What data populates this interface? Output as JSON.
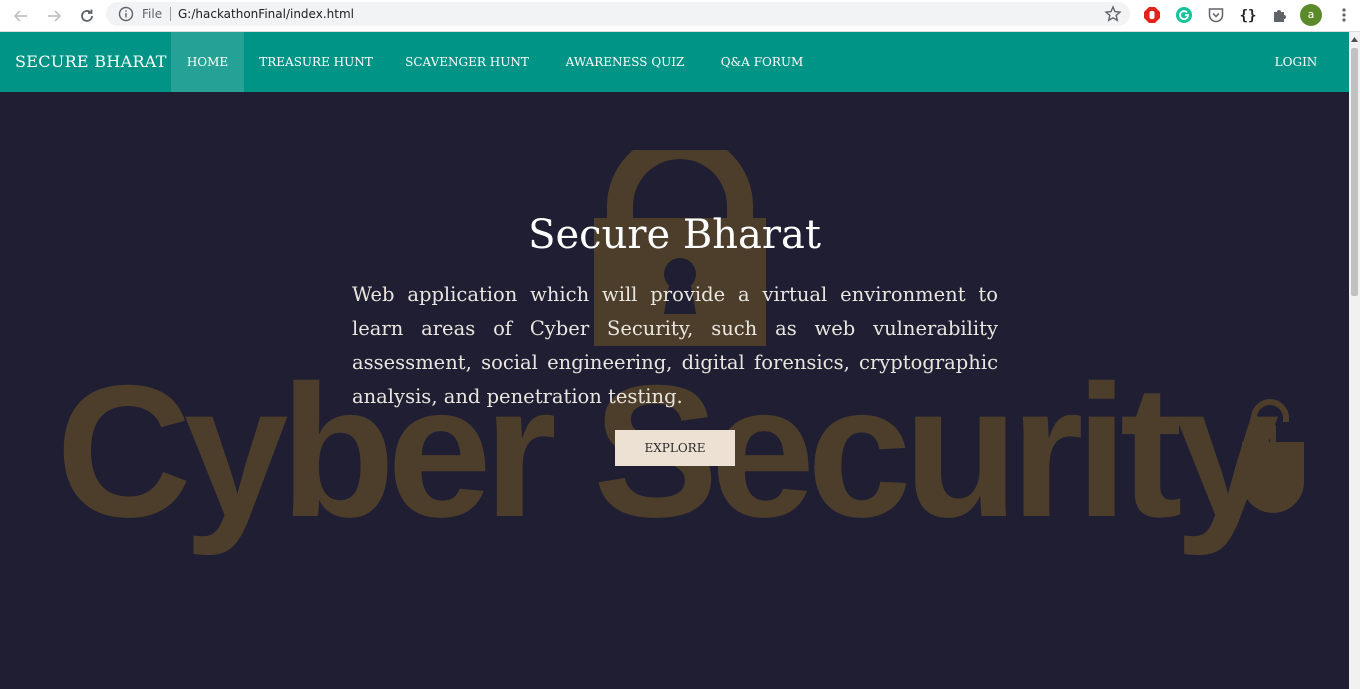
{
  "browser": {
    "omnibox": {
      "scheme_label": "File",
      "url": "G:/hackathonFinal/index.html"
    },
    "profile_initial": "a",
    "extensions": [
      "adblock-icon",
      "grammarly-icon",
      "pocket-icon",
      "json-viewer-icon",
      "puzzle-icon"
    ],
    "colors": {
      "adblock": "#e2231a",
      "grammarly": "#15c39a",
      "profile": "#5b8a2a"
    }
  },
  "site": {
    "brand": "SECURE BHARAT",
    "nav": {
      "home": "HOME",
      "treasure_hunt": "TREASURE HUNT",
      "scavenger_hunt": "SCAVENGER HUNT",
      "awareness_quiz": "AWARENESS QUIZ",
      "qa_forum": "Q&A FORUM",
      "login": "LOGIN"
    },
    "colors": {
      "navbar": "#009487",
      "hero_bg": "#1f1e32",
      "button_bg": "#ede1d4"
    }
  },
  "hero": {
    "background_text": "Cyber Security",
    "title": "Secure Bharat",
    "description": "Web application which will provide a virtual environment to learn areas of Cyber Security, such as web vulnerability assessment, social engineering, digital forensics, cryptographic analysis, and penetration testing.",
    "explore_label": "EXPLORE"
  }
}
